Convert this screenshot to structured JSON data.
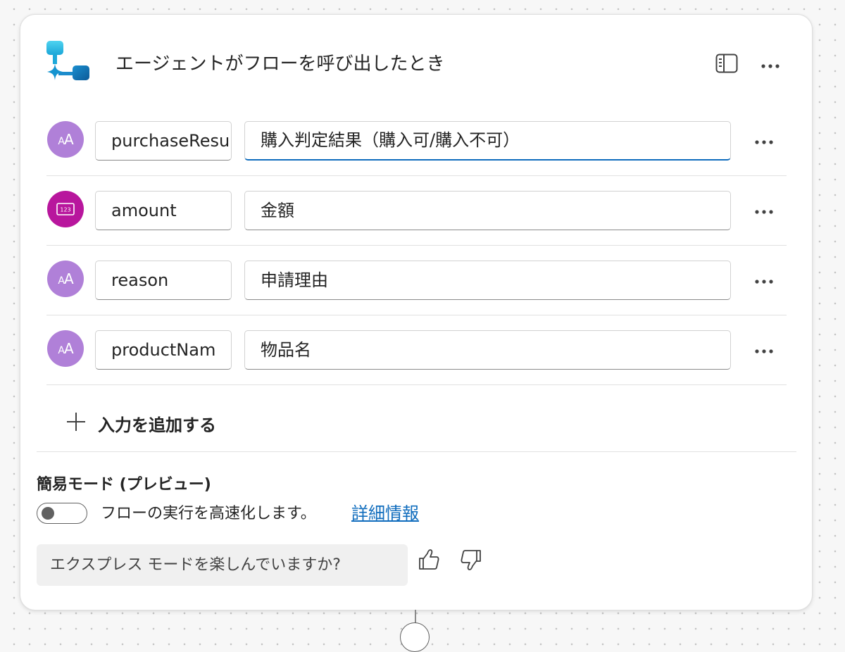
{
  "header": {
    "logo_icon": "agent-flow-trigger-icon",
    "title": "エージェントがフローを呼び出したとき",
    "panel_icon": "side-panel-icon",
    "more_icon": "more-horizontal-icon"
  },
  "inputs": [
    {
      "type": "text",
      "type_icon": "text-type-icon",
      "name": "purchaseResu",
      "description": "購入判定結果（購入可/購入不可）",
      "focused": true
    },
    {
      "type": "number",
      "type_icon": "number-type-icon",
      "name": "amount",
      "description": "金額",
      "focused": false
    },
    {
      "type": "text",
      "type_icon": "text-type-icon",
      "name": "reason",
      "description": "申請理由",
      "focused": false
    },
    {
      "type": "text",
      "type_icon": "text-type-icon",
      "name": "productNam",
      "description": "物品名",
      "focused": false
    }
  ],
  "add_input": {
    "icon": "plus-icon",
    "label": "入力を追加する"
  },
  "simple_mode": {
    "title": "簡易モード (プレビュー)",
    "toggle_on": false,
    "description": "フローの実行を高速化します。",
    "learn_more": "詳細情報"
  },
  "feedback": {
    "question": "エクスプレス モードを楽しんでいますか?",
    "thumb_up_icon": "thumbs-up-icon",
    "thumb_down_icon": "thumbs-down-icon"
  },
  "colors": {
    "accent": "#0f6cbd",
    "text_type": "#b080d8",
    "number_type": "#b8169d",
    "logo_light": "#3cc6e8",
    "logo_dark": "#0e6aa8"
  }
}
